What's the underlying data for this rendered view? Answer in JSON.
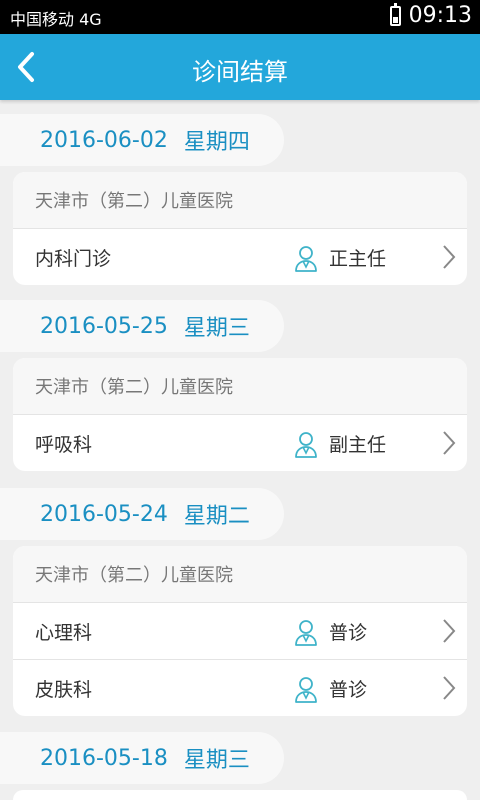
{
  "status": {
    "carrier": "中国移动 4G",
    "time": "09:13"
  },
  "header": {
    "title": "诊间结算",
    "back_icon": "chevron-left-icon"
  },
  "groups": [
    {
      "date": "2016-06-02",
      "weekday": "星期四",
      "hospital": "天津市（第二）儿童医院",
      "items": [
        {
          "department": "内科门诊",
          "doctor": "正主任"
        }
      ]
    },
    {
      "date": "2016-05-25",
      "weekday": "星期三",
      "hospital": "天津市（第二）儿童医院",
      "items": [
        {
          "department": "呼吸科",
          "doctor": "副主任"
        }
      ]
    },
    {
      "date": "2016-05-24",
      "weekday": "星期二",
      "hospital": "天津市（第二）儿童医院",
      "items": [
        {
          "department": "心理科",
          "doctor": "普诊"
        },
        {
          "department": "皮肤科",
          "doctor": "普诊"
        }
      ]
    },
    {
      "date": "2016-05-18",
      "weekday": "星期三"
    }
  ],
  "colors": {
    "header_bg": "#23a7db",
    "date_text": "#1a8fc2",
    "icon_teal": "#3fb3c9"
  }
}
